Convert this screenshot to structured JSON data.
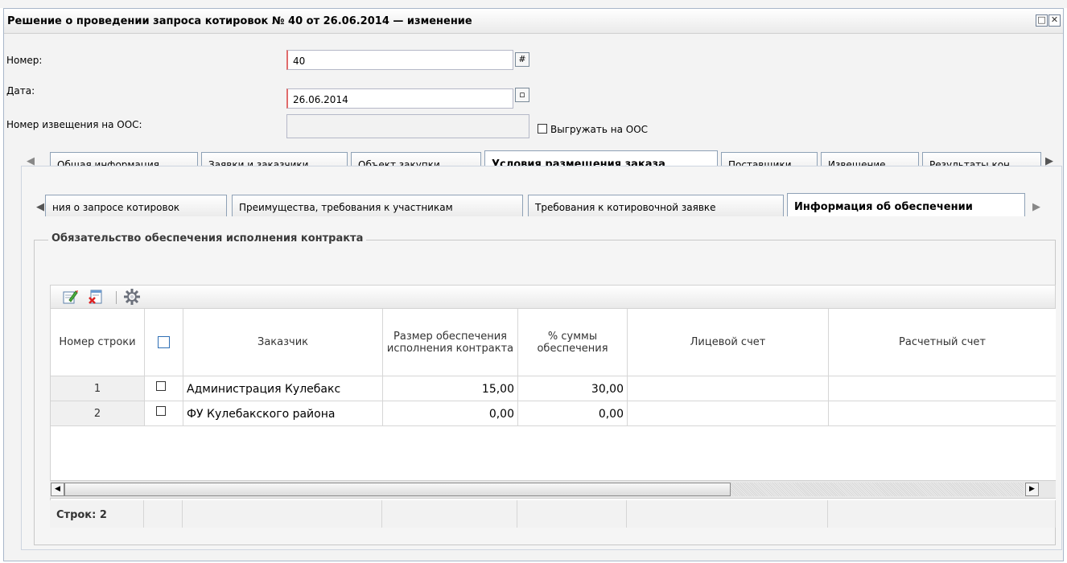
{
  "window": {
    "title": "Решение о проведении запроса котировок № 40 от 26.06.2014 — изменение",
    "buttons": {
      "restore": "□",
      "close": "✕"
    }
  },
  "form": {
    "number_label": "Номер:",
    "number_value": "40",
    "date_label": "Дата:",
    "date_value": "26.06.2014",
    "notice_label": "Номер извещения на ООС:",
    "notice_value": "",
    "export_label": "Выгружать на ООС"
  },
  "main_tabs": [
    "Общая информация",
    "Заявки и заказчики",
    "Объект закупки",
    "Условия размещения заказа",
    "Поставщики",
    "Извещение",
    "Результаты кон"
  ],
  "main_tab_active": "Условия размещения заказа",
  "sub_tabs": [
    "ния о запросе котировок",
    "Преимущества, требования к участникам",
    "Требования к котировочной заявке",
    "Информация об обеспечении"
  ],
  "section_title": "Обязательство обеспечения исполнения контракта",
  "toolbar": {
    "icons": [
      "edit-icon",
      "delete-icon",
      "settings-icon"
    ]
  },
  "table": {
    "columns": [
      "Номер строки",
      "",
      "Заказчик",
      "Размер обеспечения исполнения контракта",
      "% суммы обеспечения",
      "Лицевой счет",
      "Расчетный счет"
    ],
    "rows": [
      {
        "num": "1",
        "customer": "Администрация Кулебакс",
        "size": "15,00",
        "percent": "30,00",
        "personal_account": "",
        "settlement_account": ""
      },
      {
        "num": "2",
        "customer": "ФУ Кулебакского района",
        "size": "0,00",
        "percent": "0,00",
        "personal_account": "",
        "settlement_account": ""
      }
    ],
    "row_count_label": "Строк: 2"
  }
}
